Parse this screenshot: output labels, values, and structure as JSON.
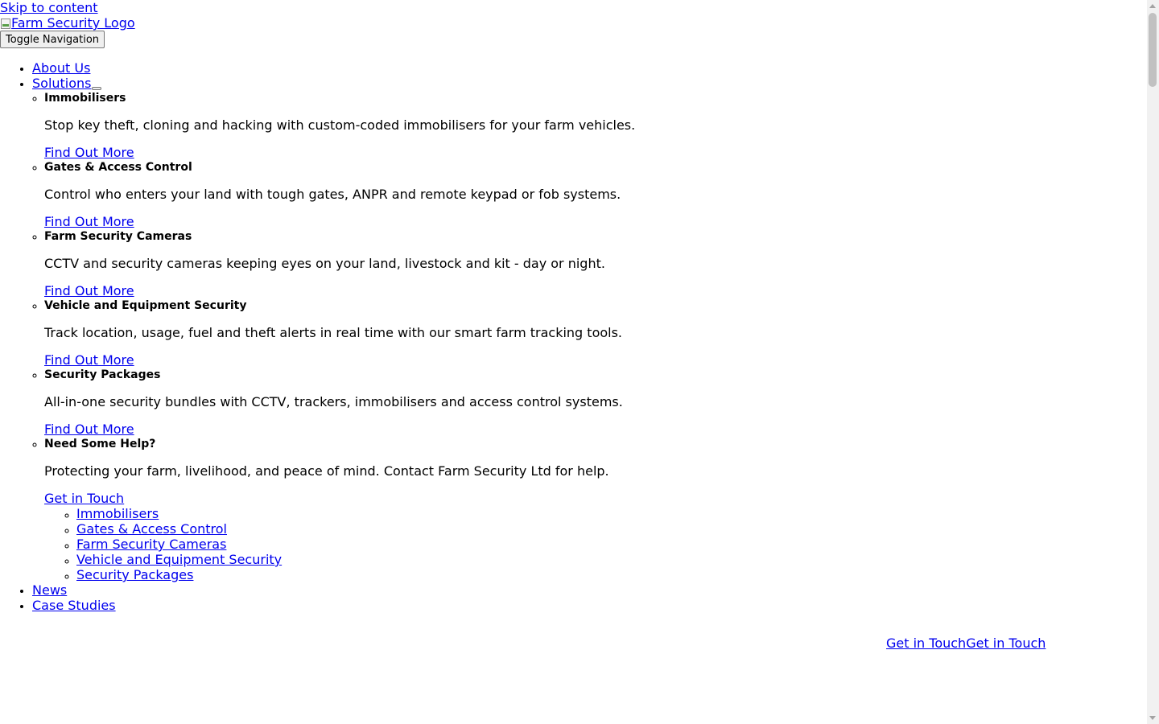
{
  "skip_link": "Skip to content",
  "logo": {
    "alt_text": "Farm Security Logo",
    "icon": "broken-image-icon"
  },
  "toggle_nav": "Toggle Navigation",
  "nav": {
    "about": "About Us",
    "solutions": "Solutions",
    "news": "News",
    "case_studies": "Case Studies"
  },
  "mega_menu": [
    {
      "title": "Immobilisers",
      "description": "Stop key theft, cloning and hacking with custom-coded immobilisers for your farm vehicles.",
      "link": "Find Out More"
    },
    {
      "title": "Gates & Access Control",
      "description": "Control who enters your land with tough gates, ANPR and remote keypad or fob systems.",
      "link": "Find Out More"
    },
    {
      "title": "Farm Security Cameras",
      "description": "CCTV and security cameras keeping eyes on your land, livestock and kit - day or night.",
      "link": "Find Out More"
    },
    {
      "title": "Vehicle and Equipment Security",
      "description": "Track location, usage, fuel and theft alerts in real time with our smart farm tracking tools.",
      "link": "Find Out More"
    },
    {
      "title": "Security Packages",
      "description": "All-in-one security bundles with CCTV, trackers, immobilisers and access control systems.",
      "link": "Find Out More"
    },
    {
      "title": "Need Some Help?",
      "description": "Protecting your farm, livelihood, and peace of mind. Contact Farm Security Ltd for help.",
      "link": "Get in Touch"
    }
  ],
  "solutions_sub": [
    "Immobilisers",
    "Gates & Access Control",
    "Farm Security Cameras",
    "Vehicle and Equipment Security",
    "Security Packages"
  ],
  "cta": {
    "first": "Get in Touch",
    "second": "Get in Touch"
  },
  "colors": {
    "link": "#0000ee",
    "text": "#000000",
    "background": "#ffffff"
  }
}
